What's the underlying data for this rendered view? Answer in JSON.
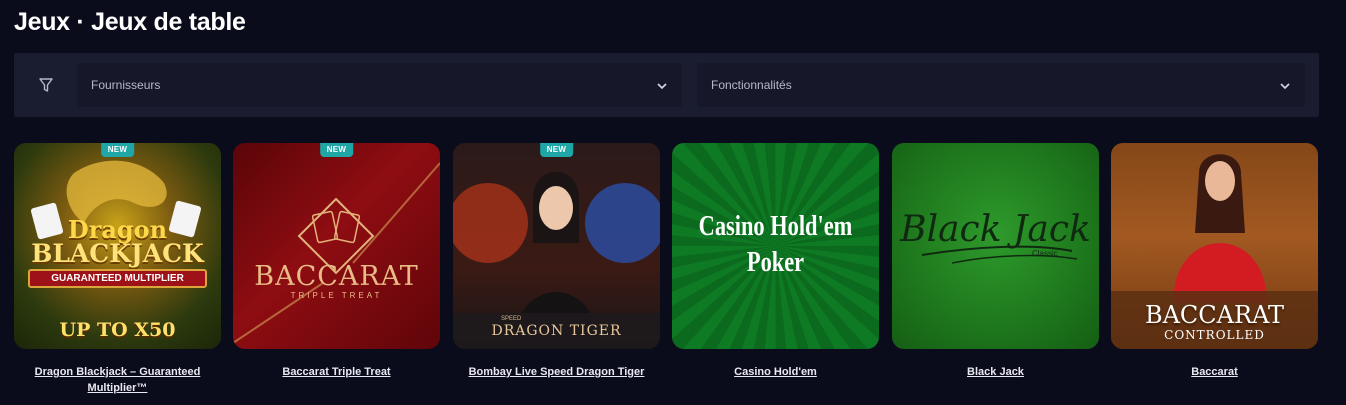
{
  "header": {
    "title": "Jeux · Jeux de table"
  },
  "filters": {
    "providers_label": "Fournisseurs",
    "features_label": "Fonctionnalités"
  },
  "colors": {
    "background": "#0b0c1b",
    "filter_bar": "#1a1c2f",
    "badge": "#1fa7a8"
  },
  "games": [
    {
      "name": "Dragon Blackjack – Guaranteed Multiplier™",
      "badge": "NEW",
      "art_title_1": "Dragon",
      "art_title_2": "BLACKJACK",
      "art_sub": "GUARANTEED MULTIPLIER",
      "art_footer": "UP TO X50"
    },
    {
      "name": "Baccarat Triple Treat",
      "badge": "NEW",
      "art_title_1": "BACCARAT",
      "art_sub": "TRIPLE TREAT"
    },
    {
      "name": "Bombay Live Speed Dragon Tiger",
      "badge": "NEW",
      "art_small": "SPEED",
      "art_title_1": "DRAGON TIGER"
    },
    {
      "name": "Casino Hold'em",
      "art_title_1": "Casino Hold'em",
      "art_title_2": "Poker"
    },
    {
      "name": "Black Jack",
      "art_title_1": "Black Jack",
      "art_sub": "Classic"
    },
    {
      "name": "Baccarat",
      "art_title_1": "BACCARAT",
      "art_sub": "CONTROLLED"
    }
  ]
}
